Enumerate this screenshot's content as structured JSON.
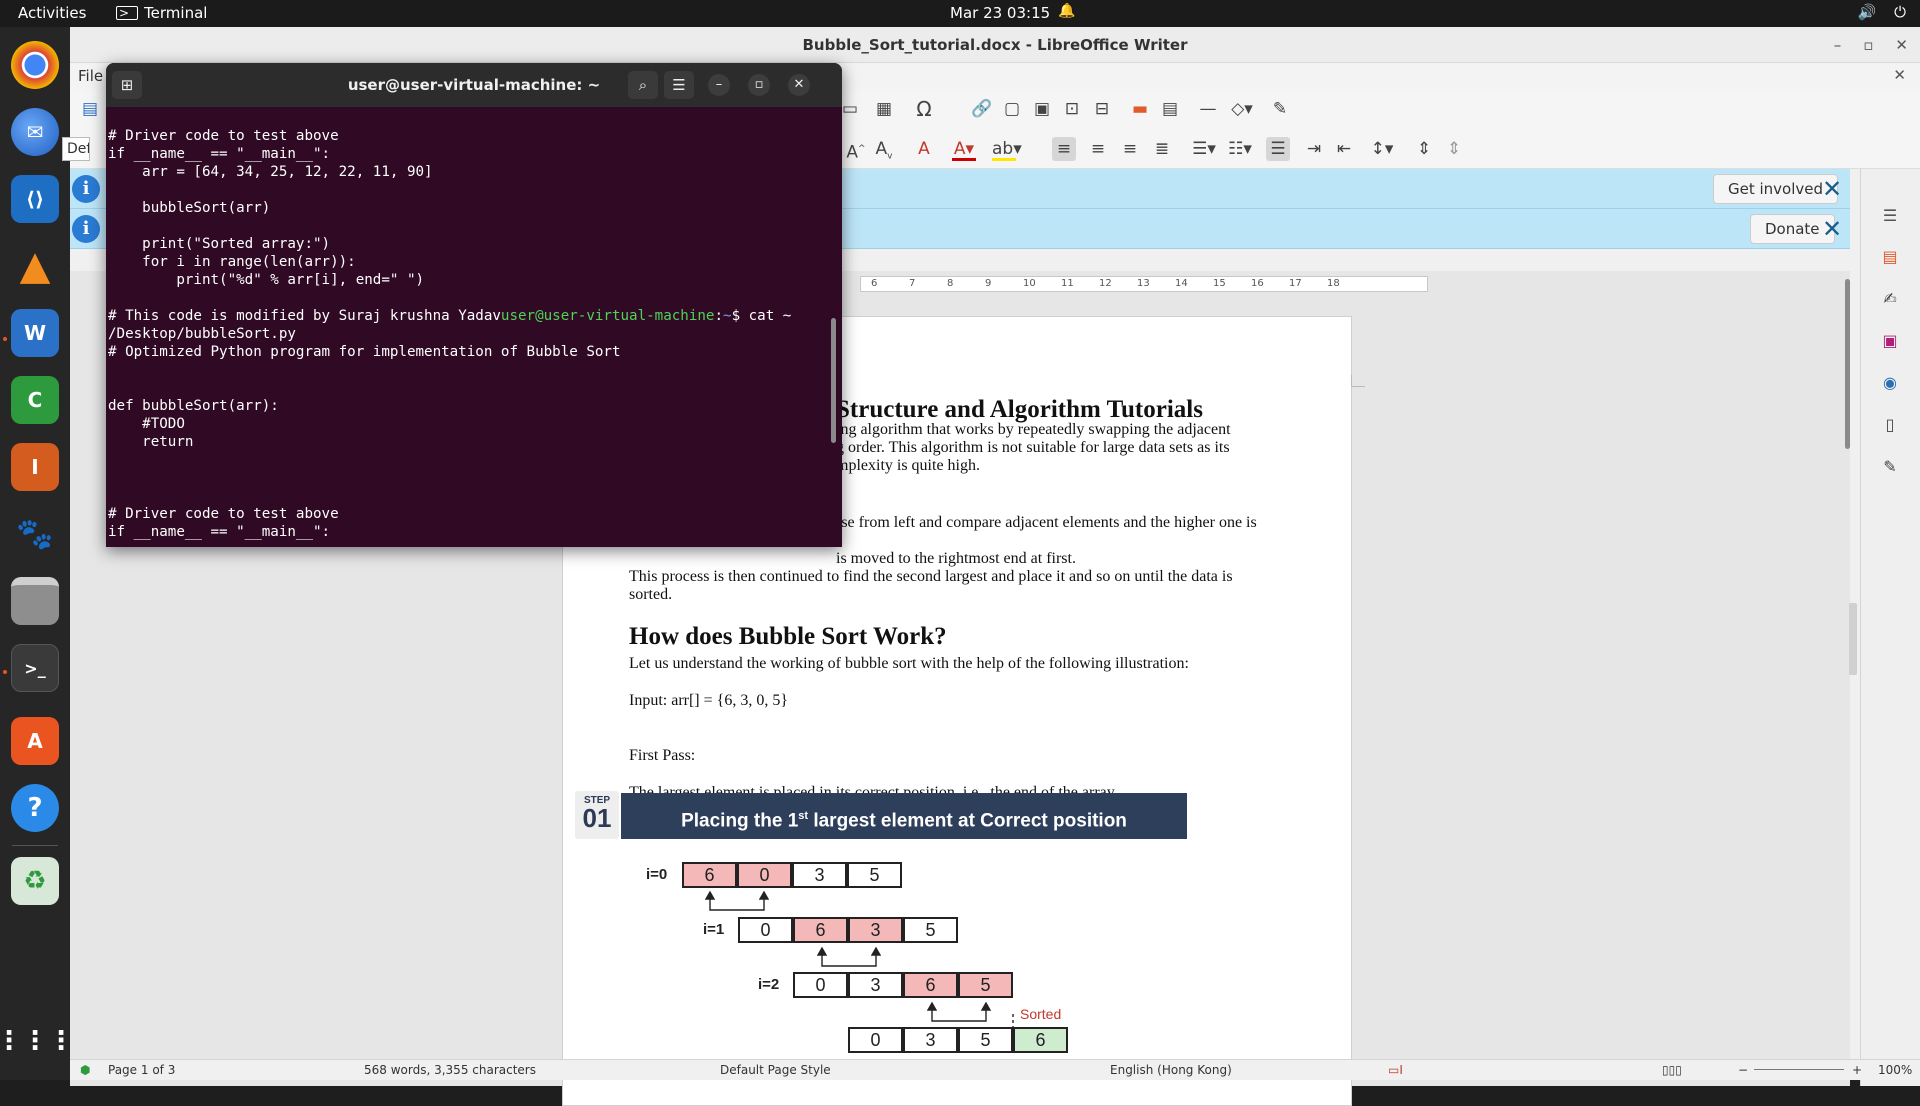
{
  "topbar": {
    "activities": "Activities",
    "app_name": "Terminal",
    "clock": "Mar 23  03:15"
  },
  "dock": {
    "items": [
      "Google Chrome",
      "Thunderbird",
      "Visual Studio Code",
      "VLC",
      "LibreOffice Writer",
      "LibreOffice Calc",
      "LibreOffice Impress",
      "GIMP",
      "Files",
      "Terminal",
      "Ubuntu Software",
      "Help",
      "Trash",
      "Show Applications"
    ]
  },
  "writer": {
    "title": "Bubble_Sort_tutorial.docx - LibreOffice Writer",
    "menu_file": "File",
    "style_box": "Def",
    "infobar1_button": "Get involved",
    "infobar2_button": "Donate",
    "ruler_ticks": [
      "6",
      "7",
      "8",
      "9",
      "10",
      "11",
      "12",
      "13",
      "14",
      "15",
      "16",
      "17",
      "18"
    ],
    "doc": {
      "heading1": "Structure and Algorithm Tutorials",
      "para1_line1": "ing algorithm that works by repeatedly swapping the adjacent",
      "para1_line2": "g order. This algorithm is not suitable for large data sets as its",
      "para1_line3": "mplexity is quite high.",
      "para2_line1": "rse from left and compare adjacent elements and the higher one is",
      "para2_line2": "is moved to the rightmost end at first.",
      "para3_line1": "This process is then continued to find the second largest and place it and so on until the data is",
      "para3_line2": "sorted.",
      "heading2": "How does Bubble Sort Work?",
      "para4": "Let us understand the working of bubble sort with the help of the following illustration:",
      "input": "Input: arr[] = {6, 3, 0, 5}",
      "first_pass": "First Pass:",
      "para5": "The largest element is placed in its correct position, i.e., the end of the array."
    },
    "figure": {
      "step_word": "STEP",
      "step_num": "01",
      "banner_prefix": "Placing the 1",
      "banner_sup": "st",
      "banner_suffix": " largest element at Correct position",
      "rows": [
        {
          "label": "i=0",
          "cells": [
            "6",
            "0",
            "3",
            "5"
          ]
        },
        {
          "label": "i=1",
          "cells": [
            "0",
            "6",
            "3",
            "5"
          ]
        },
        {
          "label": "i=2",
          "cells": [
            "0",
            "3",
            "6",
            "5"
          ]
        },
        {
          "label": "",
          "cells": [
            "0",
            "3",
            "5",
            "6"
          ]
        }
      ],
      "sorted_label": "Sorted"
    },
    "status": {
      "page": "Page 1 of 3",
      "words": "568 words, 3,355 characters",
      "page_style": "Default Page Style",
      "language": "English (Hong Kong)",
      "zoom": "100%"
    }
  },
  "terminal": {
    "title": "user@user-virtual-machine: ~",
    "lines": [
      {
        "text": "# Driver code to test above"
      },
      {
        "text": "if __name__ == \"__main__\":"
      },
      {
        "text": "    arr = [64, 34, 25, 12, 22, 11, 90]"
      },
      {
        "text": ""
      },
      {
        "text": "    bubbleSort(arr)"
      },
      {
        "text": ""
      },
      {
        "text": "    print(\"Sorted array:\")"
      },
      {
        "text": "    for i in range(len(arr)):"
      },
      {
        "text": "        print(\"%d\" % arr[i], end=\" \")"
      },
      {
        "text": ""
      },
      {
        "text": "# This code is modified by Suraj krushna Yadav",
        "prompt_user": "user@user-virtual-machine",
        "prompt_sep": ":",
        "prompt_path": "~",
        "prompt_cmd": "$ cat ~"
      },
      {
        "text": "/Desktop/bubbleSort.py"
      },
      {
        "text": "# Optimized Python program for implementation of Bubble Sort"
      },
      {
        "text": ""
      },
      {
        "text": ""
      },
      {
        "text": "def bubbleSort(arr):"
      },
      {
        "text": "    #TODO"
      },
      {
        "text": "    return"
      },
      {
        "text": ""
      },
      {
        "text": ""
      },
      {
        "text": ""
      },
      {
        "text": "# Driver code to test above"
      },
      {
        "text": "if __name__ == \"__main__\":"
      }
    ]
  },
  "colors": {
    "terminal_bg": "#300a24",
    "prompt_user": "#4fd256",
    "prompt_path": "#6f9fe6",
    "ubuntu_orange": "#e95420",
    "banner": "#2e3f5c",
    "infobar": "#bde5f8"
  }
}
